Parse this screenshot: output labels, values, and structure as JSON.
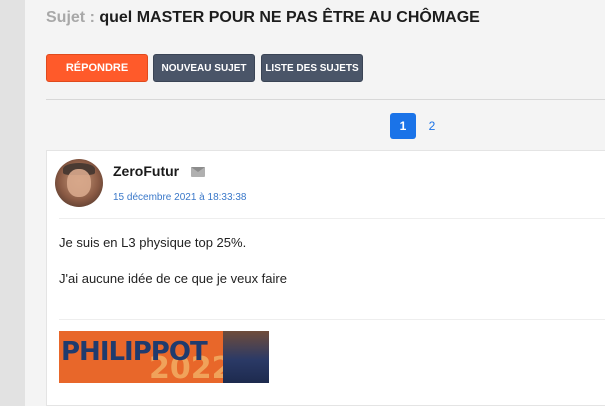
{
  "topic": {
    "prefix": "Sujet",
    "separator": ":",
    "title": "quel MASTER POUR NE PAS ÊTRE AU CHÔMAGE"
  },
  "toolbar": {
    "reply_label": "RÉPONDRE",
    "new_topic_label": "NOUVEAU SUJET",
    "topic_list_label": "LISTE DES SUJETS"
  },
  "pagination": {
    "current": "1",
    "next": "2"
  },
  "post": {
    "author": "ZeroFutur",
    "date": "15 décembre 2021 à 18:33:38",
    "lines": [
      "Je suis en L3 physique top 25%.",
      "J'ai aucune idée de ce que je veux faire"
    ],
    "signature": {
      "text": "PHILIPPOT",
      "number": "2022"
    }
  },
  "colors": {
    "reply": "#ff5a2a",
    "secondary": "#4a5568",
    "link": "#1a73e8"
  }
}
